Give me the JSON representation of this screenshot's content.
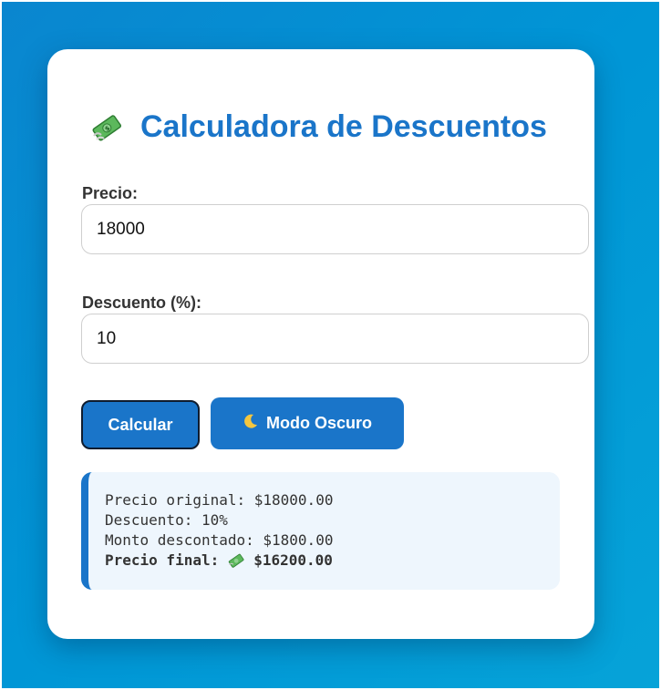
{
  "app": {
    "title": "Calculadora de Descuentos",
    "title_icon": "money-with-wings-icon"
  },
  "form": {
    "price_label": "Precio:",
    "price_value": "18000",
    "discount_label": "Descuento (%):",
    "discount_value": "10"
  },
  "buttons": {
    "calculate_label": "Calcular",
    "dark_mode_label": "Modo Oscuro",
    "dark_mode_icon": "moon-icon"
  },
  "result": {
    "original_line": "Precio original: $18000.00",
    "discount_line": "Descuento: 10%",
    "amount_line": "Monto descontado: $1800.00",
    "final_label": "Precio final:",
    "final_value": "$16200.00",
    "final_icon": "money-with-wings-icon"
  },
  "colors": {
    "accent": "#1a75c9",
    "background_gradient": [
      "#0a86cf",
      "#06a3d8"
    ],
    "result_bg": "#eef6fd"
  }
}
